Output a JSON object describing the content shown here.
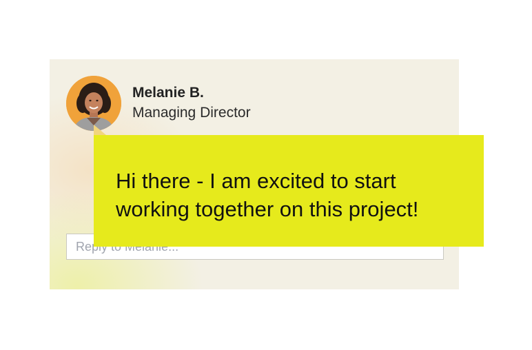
{
  "author": {
    "name": "Melanie B.",
    "title": "Managing Director"
  },
  "message": {
    "text": "Hi there - I am excited to start working together on this project!"
  },
  "reply": {
    "placeholder": "Reply to Melanie..."
  },
  "colors": {
    "card_background": "#f3f0e4",
    "bubble_background": "#e6ea1c",
    "avatar_background": "#f0a23a"
  }
}
